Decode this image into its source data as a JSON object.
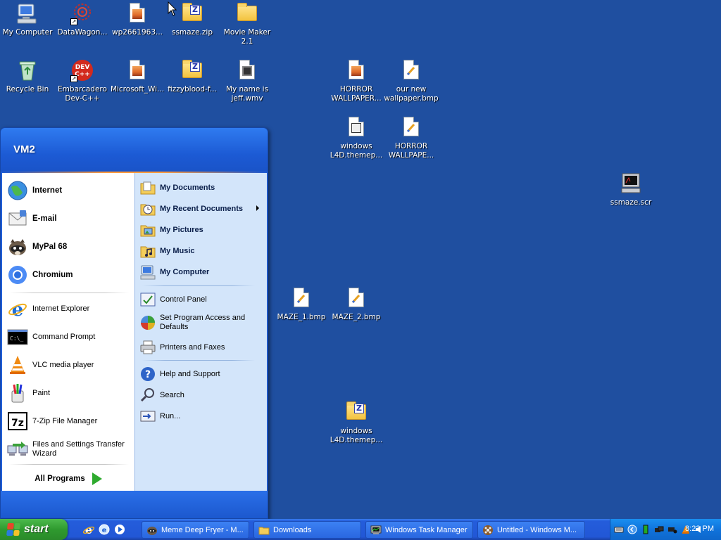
{
  "desktop": {
    "icons": [
      {
        "label": "My Computer",
        "icon": "my-computer-icon"
      },
      {
        "label": "DataWagon...",
        "icon": "datawagon-icon"
      },
      {
        "label": "wp2661963...",
        "icon": "image-file-icon"
      },
      {
        "label": "ssmaze.zip",
        "icon": "zip-folder-icon"
      },
      {
        "label": "Movie Maker 2.1",
        "icon": "folder-icon"
      },
      {
        "label": "Recycle Bin",
        "icon": "recycle-bin-icon"
      },
      {
        "label": "Embarcadero Dev-C++",
        "icon": "dev-cpp-icon"
      },
      {
        "label": "Microsoft_Wi...",
        "icon": "image-file-icon"
      },
      {
        "label": "fizzyblood-f...",
        "icon": "zip-folder-icon"
      },
      {
        "label": "My name is jeff.wmv",
        "icon": "video-file-icon"
      },
      {
        "label": "HORROR WALLPAPER...",
        "icon": "image-file-icon"
      },
      {
        "label": "our new wallpaper.bmp",
        "icon": "bmp-file-icon"
      },
      {
        "label": "windows L4D.themep...",
        "icon": "theme-file-icon"
      },
      {
        "label": "HORROR WALLPAPE...",
        "icon": "bmp-file-icon"
      },
      {
        "label": "ssmaze.scr",
        "icon": "screensaver-icon"
      },
      {
        "label": "MAZE_1.bmp",
        "icon": "bmp-file-icon"
      },
      {
        "label": "MAZE_2.bmp",
        "icon": "bmp-file-icon"
      },
      {
        "label": "windows L4D.themep...",
        "icon": "zip-folder-icon"
      }
    ]
  },
  "start_menu": {
    "user_name": "VM2",
    "pinned": [
      {
        "label": "Internet",
        "icon": "globe-icon"
      },
      {
        "label": "E-mail",
        "icon": "email-icon"
      },
      {
        "label": "MyPal 68",
        "icon": "mypal-raccoon-icon"
      },
      {
        "label": "Chromium",
        "icon": "chromium-icon"
      }
    ],
    "frequent": [
      {
        "label": "Internet Explorer",
        "icon": "internet-explorer-icon"
      },
      {
        "label": "Command Prompt",
        "icon": "command-prompt-icon"
      },
      {
        "label": "VLC media player",
        "icon": "vlc-icon"
      },
      {
        "label": "Paint",
        "icon": "paint-icon"
      },
      {
        "label": "7-Zip File Manager",
        "icon": "7zip-icon"
      },
      {
        "label": "Files and Settings Transfer Wizard",
        "icon": "transfer-wizard-icon"
      }
    ],
    "all_programs": "All Programs",
    "places": [
      {
        "label": "My Documents",
        "icon": "my-documents-icon",
        "bold": true
      },
      {
        "label": "My Recent Documents",
        "icon": "recent-documents-icon",
        "bold": true,
        "submenu": true
      },
      {
        "label": "My Pictures",
        "icon": "my-pictures-icon",
        "bold": true
      },
      {
        "label": "My Music",
        "icon": "my-music-icon",
        "bold": true
      },
      {
        "label": "My Computer",
        "icon": "my-computer-icon",
        "bold": true
      },
      {
        "label": "Control Panel",
        "icon": "control-panel-icon",
        "bold": false
      },
      {
        "label": "Set Program Access and Defaults",
        "icon": "program-access-icon",
        "bold": false
      },
      {
        "label": "Printers and Faxes",
        "icon": "printer-icon",
        "bold": false
      },
      {
        "label": "Help and Support",
        "icon": "help-icon",
        "bold": false
      },
      {
        "label": "Search",
        "icon": "search-icon",
        "bold": false
      },
      {
        "label": "Run...",
        "icon": "run-icon",
        "bold": false
      }
    ]
  },
  "taskbar": {
    "start_label": "start",
    "tasks": [
      {
        "label": "Meme Deep Fryer - M...",
        "icon": "mypal-raccoon-icon"
      },
      {
        "label": "Downloads",
        "icon": "folder-icon"
      },
      {
        "label": "Windows Task Manager",
        "icon": "task-manager-icon"
      },
      {
        "label": "Untitled - Windows M...",
        "icon": "movie-maker-icon"
      }
    ],
    "clock": "8:23 PM"
  },
  "colors": {
    "desktop": "#1f4fa0",
    "start_green": "#2f9a2f",
    "taskbar_blue": "#2257d6",
    "tray_blue": "#1073db"
  }
}
